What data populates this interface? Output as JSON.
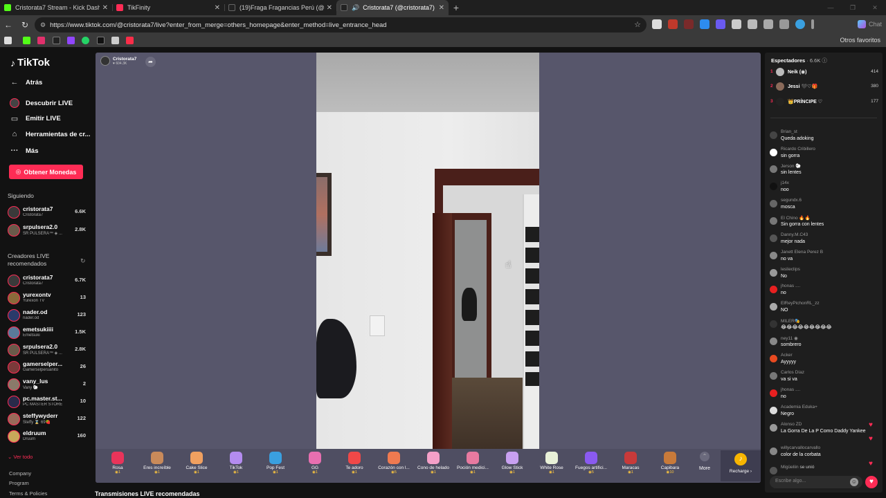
{
  "browser": {
    "tabs": [
      {
        "title": "Cristorata7 Stream - Kick Dashboard",
        "favicon_color": "#53fc18"
      },
      {
        "title": "TikFinity",
        "favicon_color": "#fe2c55"
      },
      {
        "title": "(19)Fraga Fragancias Perú (@fraga...",
        "favicon_color": "#222222"
      },
      {
        "title": "Cristorata7 (@cristorata7) es...",
        "favicon_color": "#222222"
      }
    ],
    "tab_close": "✕",
    "new_tab": "+",
    "url": "https://www.tiktok.com/@cristorata7/live?enter_from_merge=others_homepage&enter_method=live_entrance_head",
    "chat_label": "Chat",
    "bookmarks_other": "Otros favoritos"
  },
  "sidebar": {
    "brand": "TikTok",
    "back": "Atrás",
    "nav": [
      "Descubrir LIVE",
      "Emitir LIVE",
      "Herramientas de cr...",
      "Más"
    ],
    "coins_button": "Obtener Monedas",
    "following_header": "Siguiendo",
    "following": [
      {
        "name": "cristorata7",
        "sub": "Cristorata7",
        "count": "6.6K"
      },
      {
        "name": "srpulsera2.0",
        "sub": "SR PULSERA™ ◈ ...",
        "count": "2.8K"
      }
    ],
    "recommended_header": "Creadores LIVE recomendados",
    "recommended": [
      {
        "name": "cristorata7",
        "sub": "Cristorata7",
        "count": "6.7K"
      },
      {
        "name": "yurexontv",
        "sub": "Yurexon TV",
        "count": "13"
      },
      {
        "name": "nader.od",
        "sub": "nader.od",
        "count": "123"
      },
      {
        "name": "emetsukiiii",
        "sub": "Emetsuki",
        "count": "1.5K"
      },
      {
        "name": "srpulsera2.0",
        "sub": "SR PULSERA™ ◈ ...",
        "count": "2.8K"
      },
      {
        "name": "gamerselper...",
        "sub": "Gamerselperuanito",
        "count": "26"
      },
      {
        "name": "vany_lus",
        "sub": "Vany 🐑",
        "count": "2"
      },
      {
        "name": "pc.master.st...",
        "sub": "PC MASTER STORE",
        "count": "10"
      },
      {
        "name": "steffywyderr",
        "sub": "Steffy ⌛ 69🍓",
        "count": "122"
      },
      {
        "name": "eldruum",
        "sub": "Druum",
        "count": "160"
      }
    ],
    "see_all": "Ver todo",
    "footer": [
      "Company",
      "Program",
      "Terms & Policies"
    ]
  },
  "player": {
    "host_name": "Cristorata7",
    "host_likes": "604.3K",
    "gifts": [
      {
        "name": "Rosa",
        "price": "1",
        "color": "#e8345a"
      },
      {
        "name": "Eres increíble",
        "price": "1",
        "color": "#c98a5a"
      },
      {
        "name": "Cake Slice",
        "price": "1",
        "color": "#f0a060"
      },
      {
        "name": "TikTok",
        "price": "1",
        "color": "#b48cf0"
      },
      {
        "name": "Pop Fest",
        "price": "1",
        "color": "#3aa0e0"
      },
      {
        "name": "GG",
        "price": "1",
        "color": "#e86fb0"
      },
      {
        "name": "Te adoro",
        "price": "1",
        "color": "#f04848"
      },
      {
        "name": "Corazón con l...",
        "price": "5",
        "color": "#f07a50"
      },
      {
        "name": "Cono de helado",
        "price": "1",
        "color": "#f5a0c8"
      },
      {
        "name": "Poción medici...",
        "price": "1",
        "color": "#e87aa0"
      },
      {
        "name": "Glow Stick",
        "price": "1",
        "color": "#c8a0f0"
      },
      {
        "name": "White Rose",
        "price": "1",
        "color": "#e8f0d8"
      },
      {
        "name": "Fuegos artifici...",
        "price": "5",
        "color": "#8a5af0"
      },
      {
        "name": "Maracas",
        "price": "1",
        "color": "#c83a3a"
      },
      {
        "name": "Capibara",
        "price": "10",
        "color": "#c87a3a"
      }
    ],
    "more_label": "More",
    "recharge_label": "Recharge",
    "recommended_title": "Transmisiones LIVE recomendadas"
  },
  "chat": {
    "viewers_label": "Espectadores",
    "viewers_count": "6.6K",
    "top": [
      {
        "rank": "1",
        "name": "Neik (◉)",
        "score": "414"
      },
      {
        "rank": "2",
        "name": "Jessi 🖤♡🎁",
        "score": "380"
      },
      {
        "rank": "3",
        "name": "👑PRÍNCIPE ♡",
        "score": "177"
      }
    ],
    "messages": [
      {
        "user": "Brian_st",
        "text": "Queda adoking",
        "avatar": "#444444"
      },
      {
        "user": "Ricardo Cribillero",
        "text": "sin gorra",
        "avatar": "#ffffff"
      },
      {
        "user": "Jerson 🐑",
        "text": "sin lentes",
        "avatar": "#777777"
      },
      {
        "user": "j14x",
        "text": "noo",
        "avatar": "#111111"
      },
      {
        "user": "segundx.6",
        "text": "mosca",
        "avatar": "#666666"
      },
      {
        "user": "El Chino 🔥🔥",
        "text": "Sin gorra con lentes",
        "avatar": "#777777"
      },
      {
        "user": "Danny.M.C43",
        "text": "mejor nada",
        "avatar": "#555555"
      },
      {
        "user": "Janett Elena Perez B",
        "text": "no va",
        "avatar": "#888888"
      },
      {
        "user": "leslieclips",
        "text": "No",
        "avatar": "#999999"
      },
      {
        "user": "jhonas ....",
        "text": "no",
        "avatar": "#e82020"
      },
      {
        "user": "ElReyPichonRL_zz",
        "text": "NO",
        "avatar": "#aaaaaa"
      },
      {
        "user": "MILER🎭",
        "text": "😂😂😂😂😂😂😂😂😂",
        "avatar": "#333333"
      },
      {
        "user": "ney11 ◉",
        "text": "sombrero",
        "avatar": "#888888"
      },
      {
        "user": "Acker",
        "text": "Ayyyyy",
        "avatar": "#e84a20"
      },
      {
        "user": "Carlos Díaz",
        "text": "va si va",
        "avatar": "#777777"
      },
      {
        "user": "jhonas ....",
        "text": "no",
        "avatar": "#e82020"
      },
      {
        "user": "Academia Eduka+",
        "text": "Negro",
        "avatar": "#dddddd"
      },
      {
        "user": "Alonso ZD",
        "text": "La Gorra De La P Como Daddy Yankee",
        "avatar": "#999999"
      },
      {
        "user": "willycarvallocarvallo",
        "text": "color de la corbata",
        "avatar": "#888888"
      },
      {
        "user": "Migüeliin",
        "text": "se unió",
        "avatar": "#555555"
      }
    ],
    "input_placeholder": "Escribe algo..."
  }
}
